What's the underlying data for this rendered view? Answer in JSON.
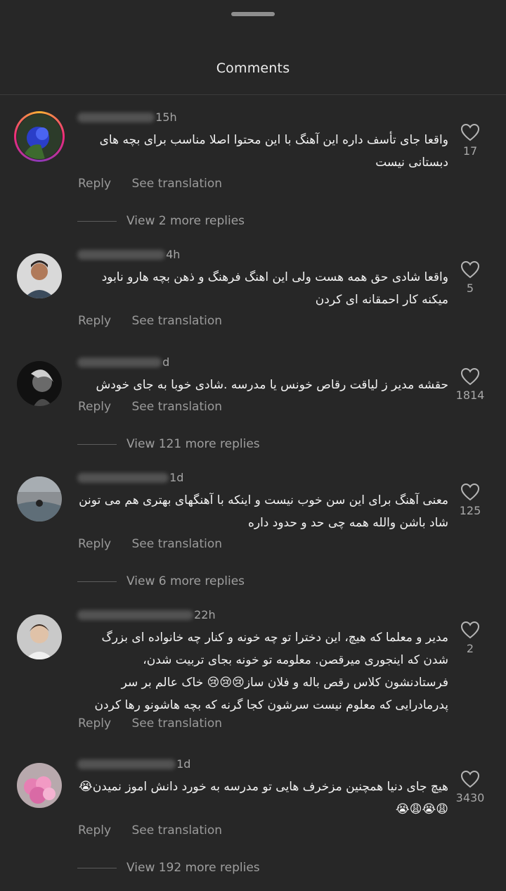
{
  "header": {
    "title": "Comments"
  },
  "actions": {
    "reply": "Reply",
    "see_translation": "See translation"
  },
  "comments": [
    {
      "time": "15h",
      "text": "واقعا جای تأسف داره این آهنگ با این محتوا اصلا مناسب برای بچه های دبستانی نیست",
      "likes": "17",
      "replies": "View 2 more replies"
    },
    {
      "time": "4h",
      "text": "واقعا شادی حق همه هست ولی این اهنگ فرهنگ و ذهن بچه هارو نابود میکنه کار احمقانه ای کردن",
      "likes": "5",
      "replies": ""
    },
    {
      "time": "d",
      "text": "حقشه مدیر ز لیاقت رقاص خونس یا مدرسه .شادی خوبا به جای خودش",
      "likes": "1814",
      "replies": "View 121 more replies"
    },
    {
      "time": "1d",
      "text": "معنی آهنگ برای این سن خوب نیست و اینکه با آهنگهای بهتری هم می تونن شاد باشن والله همه چی حد و حدود داره",
      "likes": "125",
      "replies": "View 6 more replies"
    },
    {
      "time": "22h",
      "text": "مدیر و معلما که هیچ، این دخترا تو چه خونه و کنار چه خانواده ای بزرگ شدن که اینجوری میرقصن. معلومه تو خونه بجای تربیت شدن، فرستادنشون کلاس رقص باله و فلان ساز😢😢😢 خاک عالم بر سر پدرمادرایی که معلوم نیست سرشون کجا گرنه که بچه هاشونو رها کردن",
      "likes": "2",
      "replies": ""
    },
    {
      "time": "1d",
      "text": "هیچ جای دنیا همچنین مزخرف هایی تو مدرسه به خورد دانش اموز نمیدن😭😩😭😩😭",
      "likes": "3430",
      "replies": "View 192 more replies"
    }
  ]
}
